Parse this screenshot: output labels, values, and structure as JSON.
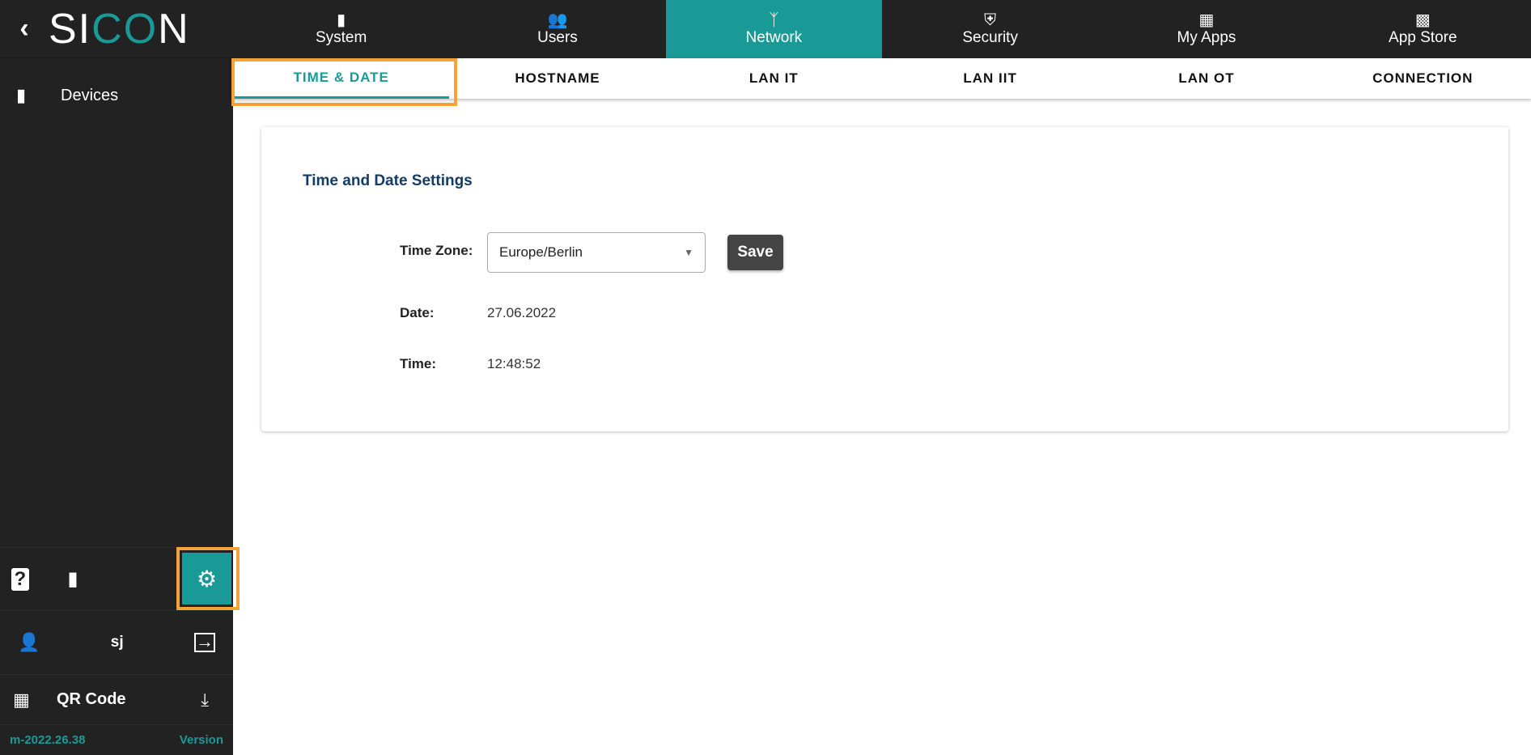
{
  "sidebar": {
    "logo": "SICON",
    "devices": "Devices",
    "user": "sj",
    "qr": "QR Code",
    "build": "m-2022.26.38",
    "version": "Version"
  },
  "topnav": [
    {
      "label": "System",
      "icon": "plug"
    },
    {
      "label": "Users",
      "icon": "users"
    },
    {
      "label": "Network",
      "icon": "network"
    },
    {
      "label": "Security",
      "icon": "shield"
    },
    {
      "label": "My Apps",
      "icon": "grid"
    },
    {
      "label": "App Store",
      "icon": "store"
    }
  ],
  "subtabs": [
    "TIME & DATE",
    "HOSTNAME",
    "LAN IT",
    "LAN IIT",
    "LAN OT",
    "CONNECTION"
  ],
  "card": {
    "title": "Time and Date Settings",
    "tz_label": "Time Zone:",
    "tz_value": "Europe/Berlin",
    "save": "Save",
    "date_label": "Date:",
    "date": "27.06.2022",
    "time_label": "Time:",
    "time": "12:48:52"
  },
  "colors": {
    "accent": "#1a9a96",
    "highlight": "#f4a338",
    "sidebar": "#222222"
  }
}
